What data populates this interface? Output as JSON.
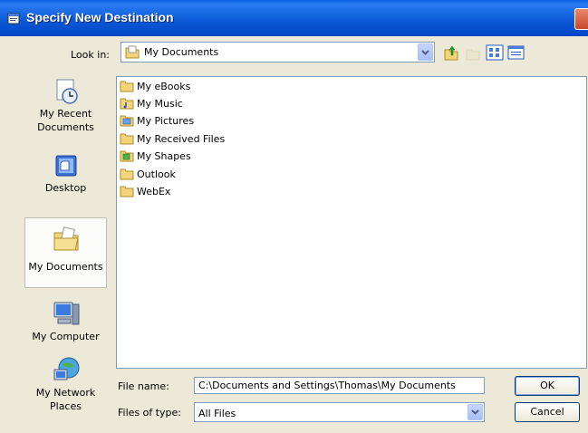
{
  "window": {
    "title": "Specify New Destination"
  },
  "look_in": {
    "label": "Look in:",
    "value": "My Documents"
  },
  "places": [
    {
      "label": "My Recent Documents",
      "icon": "recent-documents-icon",
      "selected": false
    },
    {
      "label": "Desktop",
      "icon": "desktop-icon",
      "selected": false
    },
    {
      "label": "My Documents",
      "icon": "my-documents-icon",
      "selected": true
    },
    {
      "label": "My Computer",
      "icon": "my-computer-icon",
      "selected": false
    },
    {
      "label": "My Network Places",
      "icon": "network-places-icon",
      "selected": false
    }
  ],
  "files": [
    {
      "name": "My eBooks",
      "icon": "folder-icon"
    },
    {
      "name": "My Music",
      "icon": "music-folder-icon"
    },
    {
      "name": "My Pictures",
      "icon": "pictures-folder-icon"
    },
    {
      "name": "My Received Files",
      "icon": "folder-icon"
    },
    {
      "name": "My Shapes",
      "icon": "shapes-folder-icon"
    },
    {
      "name": "Outlook",
      "icon": "folder-icon"
    },
    {
      "name": "WebEx",
      "icon": "folder-icon"
    }
  ],
  "file_name": {
    "label": "File name:",
    "value": "C:\\Documents and Settings\\Thomas\\My Documents"
  },
  "file_type": {
    "label": "Files of type:",
    "value": "All Files"
  },
  "buttons": {
    "ok": "OK",
    "cancel": "Cancel"
  },
  "colors": {
    "titlebar": "#0a5fe0",
    "dialog_bg": "#ece9d8",
    "input_border": "#7f9db9"
  }
}
